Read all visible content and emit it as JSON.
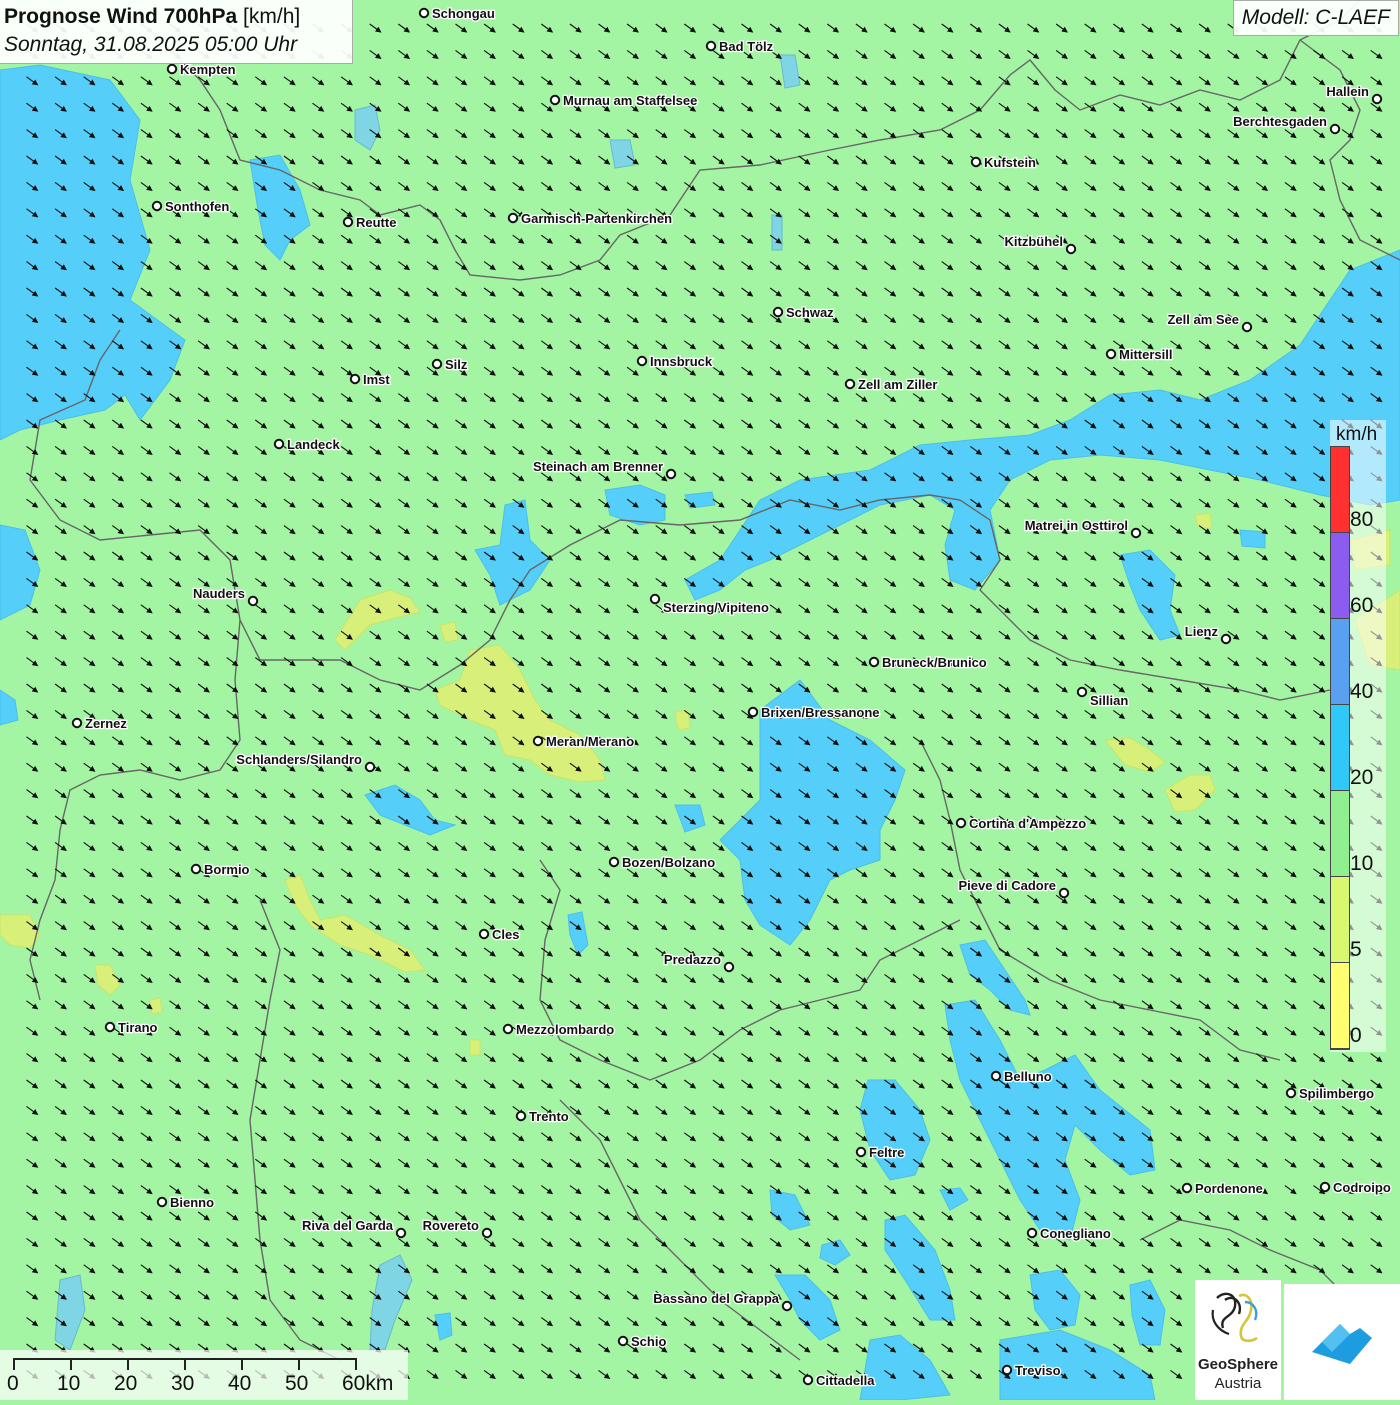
{
  "header": {
    "title_bold": "Prognose Wind 700hPa",
    "title_unit": "[km/h]",
    "date": "Sonntag, 31.08.2025 05:00 Uhr"
  },
  "model_label": "Modell: C-LAEF",
  "legend": {
    "unit": "km/h",
    "ticks": [
      "80",
      "60",
      "40",
      "20",
      "10",
      "5",
      "0"
    ],
    "colors": [
      "#ff3030",
      "#8c5cf0",
      "#5aa0f0",
      "#30c8f8",
      "#90f090",
      "#d8f870",
      "#ffff70"
    ]
  },
  "scale_bar": {
    "labels": [
      "0",
      "10",
      "20",
      "30",
      "40",
      "50",
      "60km"
    ]
  },
  "logo": {
    "name_line1": "GeoSphere",
    "name_line2": "Austria"
  },
  "wind": {
    "direction": "from northwest",
    "background_speed_class": "10-20 km/h"
  },
  "colors": {
    "background_green": "#a3f5a3",
    "blue_zone": "#55cffa",
    "yellow_zone": "#d8f07a",
    "border": "#666666"
  },
  "cities": [
    {
      "name": "Schongau"
    },
    {
      "name": "Bad Tölz"
    },
    {
      "name": "Kempten"
    },
    {
      "name": "Murnau am Staffelsee"
    },
    {
      "name": "Hallein"
    },
    {
      "name": "Berchtesgaden"
    },
    {
      "name": "Kufstein"
    },
    {
      "name": "Sonthofen"
    },
    {
      "name": "Reutte"
    },
    {
      "name": "Garmisch-Partenkirchen"
    },
    {
      "name": "Kitzbühel"
    },
    {
      "name": "Schwaz"
    },
    {
      "name": "Zell am See"
    },
    {
      "name": "Innsbruck"
    },
    {
      "name": "Mittersill"
    },
    {
      "name": "Silz"
    },
    {
      "name": "Imst"
    },
    {
      "name": "Zell am Ziller"
    },
    {
      "name": "Landeck"
    },
    {
      "name": "Steinach am Brenner"
    },
    {
      "name": "Matrei in Osttirol"
    },
    {
      "name": "Nauders"
    },
    {
      "name": "Sterzing/Vipiteno"
    },
    {
      "name": "Lienz"
    },
    {
      "name": "Bruneck/Brunico"
    },
    {
      "name": "Sillian"
    },
    {
      "name": "Zernez"
    },
    {
      "name": "Brixen/Bressanone"
    },
    {
      "name": "Meran/Merano"
    },
    {
      "name": "Schlanders/Silandro"
    },
    {
      "name": "Cortina d'Ampezzo"
    },
    {
      "name": "Bozen/Bolzano"
    },
    {
      "name": "Bormio"
    },
    {
      "name": "Pieve di Cadore"
    },
    {
      "name": "Cles"
    },
    {
      "name": "Predazzo"
    },
    {
      "name": "Tirano"
    },
    {
      "name": "Mezzolombardo"
    },
    {
      "name": "Belluno"
    },
    {
      "name": "Spilimbergo"
    },
    {
      "name": "Trento"
    },
    {
      "name": "Feltre"
    },
    {
      "name": "Pordenone"
    },
    {
      "name": "Codroipo"
    },
    {
      "name": "Bienno"
    },
    {
      "name": "Riva del Garda"
    },
    {
      "name": "Rovereto"
    },
    {
      "name": "Conegliano"
    },
    {
      "name": "Bassano del Grappa"
    },
    {
      "name": "Schio"
    },
    {
      "name": "Treviso"
    },
    {
      "name": "Cittadella"
    }
  ]
}
